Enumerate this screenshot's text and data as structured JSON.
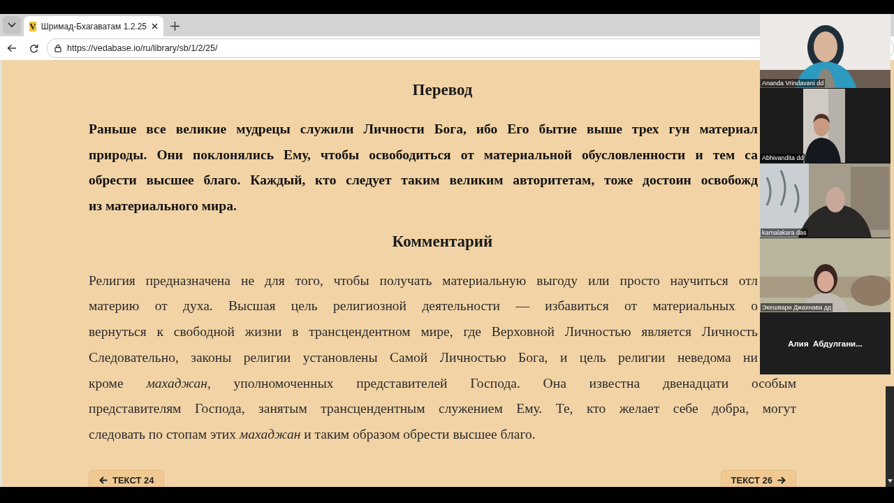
{
  "browser": {
    "tab": {
      "favicon": "V",
      "title": "Шримад-Бхагаватам 1.2.25",
      "selected": true
    },
    "address": "https://vedabase.io/ru/library/sb/1/2/25/"
  },
  "article": {
    "sections": [
      {
        "kind": "translation",
        "heading": "Перевод",
        "lines": [
          {
            "text": "Раньше все великие мудрецы служили Личности Бога, ибо Его бытие выше трех гун материал",
            "covered": true
          },
          {
            "text": "природы. Они поклонялись Ему, чтобы освободиться от материальной обусловленности и тем са",
            "covered": true
          },
          {
            "text": "обрести высшее благо. Каждый, кто следует таким великим авторитетам, тоже достоин освобожд",
            "covered": true
          },
          {
            "text": "из материального мира."
          }
        ]
      },
      {
        "kind": "purport",
        "heading": "Комментарий",
        "lines": [
          {
            "text": "Религия предназначена не для того, чтобы получать материальную выгоду или просто научиться отл",
            "covered": true
          },
          {
            "text": "материю от духа. Высшая цель религиозной деятельности — избавиться от материальных о",
            "covered": true
          },
          {
            "text": "вернуться к свободной жизни в трансцендентном мире, где Верховной Личностью является Личность",
            "covered": true
          },
          {
            "text": "Следовательно, законы религии установлены Самой Личностью Бога, и цель религии неведома ни",
            "covered": true
          },
          {
            "text": "кроме *махаджан,* уполномоченных представителей Господа. Она известна двенадцати особым",
            "covered": false
          },
          {
            "text": "представителям Господа, занятым трансцендентным служением Ему. Те, кто желает себе добра, могут",
            "covered": false
          },
          {
            "text": "следовать по стопам этих *махаджан* и таким образом обрести высшее благо."
          }
        ]
      }
    ]
  },
  "nav": [
    {
      "kind": "prev",
      "label": "ТЕКСТ 24"
    },
    {
      "kind": "next",
      "label": "ТЕКСТ 26"
    }
  ],
  "video_call": {
    "participants": [
      {
        "kind": "video",
        "name": "Ananda Vrindavani dd"
      },
      {
        "kind": "video",
        "name": "Abhivandita dd"
      },
      {
        "kind": "video",
        "name": "kamalakara das"
      },
      {
        "kind": "video",
        "name": "Экешвари Джахнава дд"
      },
      {
        "kind": "avatar",
        "name": "Алия  Абдулгани..."
      }
    ]
  }
}
